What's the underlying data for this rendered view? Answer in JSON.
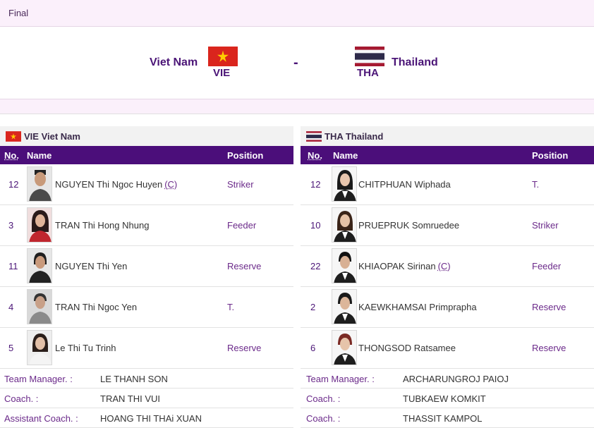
{
  "stage": "Final",
  "match": {
    "home": {
      "name": "Viet Nam",
      "code": "VIE"
    },
    "separator": "-",
    "away": {
      "name": "Thailand",
      "code": "THA"
    }
  },
  "columns": {
    "no": "No.",
    "name": "Name",
    "position": "Position"
  },
  "teams": [
    {
      "title": "VIE Viet Nam",
      "flag": "vietnam-flag",
      "players": [
        {
          "no": "12",
          "name": "NGUYEN Thi Ngoc Huyen",
          "captain": "(C)",
          "position": "Striker"
        },
        {
          "no": "3",
          "name": "TRAN Thi Hong Nhung",
          "captain": "",
          "position": "Feeder"
        },
        {
          "no": "11",
          "name": "NGUYEN Thi Yen",
          "captain": "",
          "position": "Reserve"
        },
        {
          "no": "4",
          "name": "TRAN Thi Ngoc Yen",
          "captain": "",
          "position": "T."
        },
        {
          "no": "5",
          "name": "Le Thi Tu Trinh",
          "captain": "",
          "position": "Reserve"
        }
      ],
      "officials": [
        {
          "role": "Team Manager. :",
          "name": "LE THANH SON"
        },
        {
          "role": "Coach. :",
          "name": "TRAN THI VUI"
        },
        {
          "role": "Assistant Coach. :",
          "name": "HOANG THI THAi XUAN"
        }
      ]
    },
    {
      "title": "THA Thailand",
      "flag": "thailand-flag",
      "players": [
        {
          "no": "12",
          "name": "CHITPHUAN Wiphada",
          "captain": "",
          "position": "T."
        },
        {
          "no": "10",
          "name": "PRUEPRUK Somruedee",
          "captain": "",
          "position": "Striker"
        },
        {
          "no": "22",
          "name": "KHIAOPAK Sirinan",
          "captain": "(C)",
          "position": "Feeder"
        },
        {
          "no": "2",
          "name": "KAEWKHAMSAI Primprapha",
          "captain": "",
          "position": "Reserve"
        },
        {
          "no": "6",
          "name": "THONGSOD Ratsamee",
          "captain": "",
          "position": "Reserve"
        }
      ],
      "officials": [
        {
          "role": "Team Manager. :",
          "name": "ARCHARUNGROJ PAIOJ"
        },
        {
          "role": "Coach. :",
          "name": "TUBKAEW KOMKIT"
        },
        {
          "role": "Coach. :",
          "name": "THASSIT KAMPOL"
        }
      ]
    }
  ],
  "colors": {
    "accent": "#4b0e7a",
    "text_link": "#6b2a8a",
    "tint": "#fbf0fb"
  }
}
